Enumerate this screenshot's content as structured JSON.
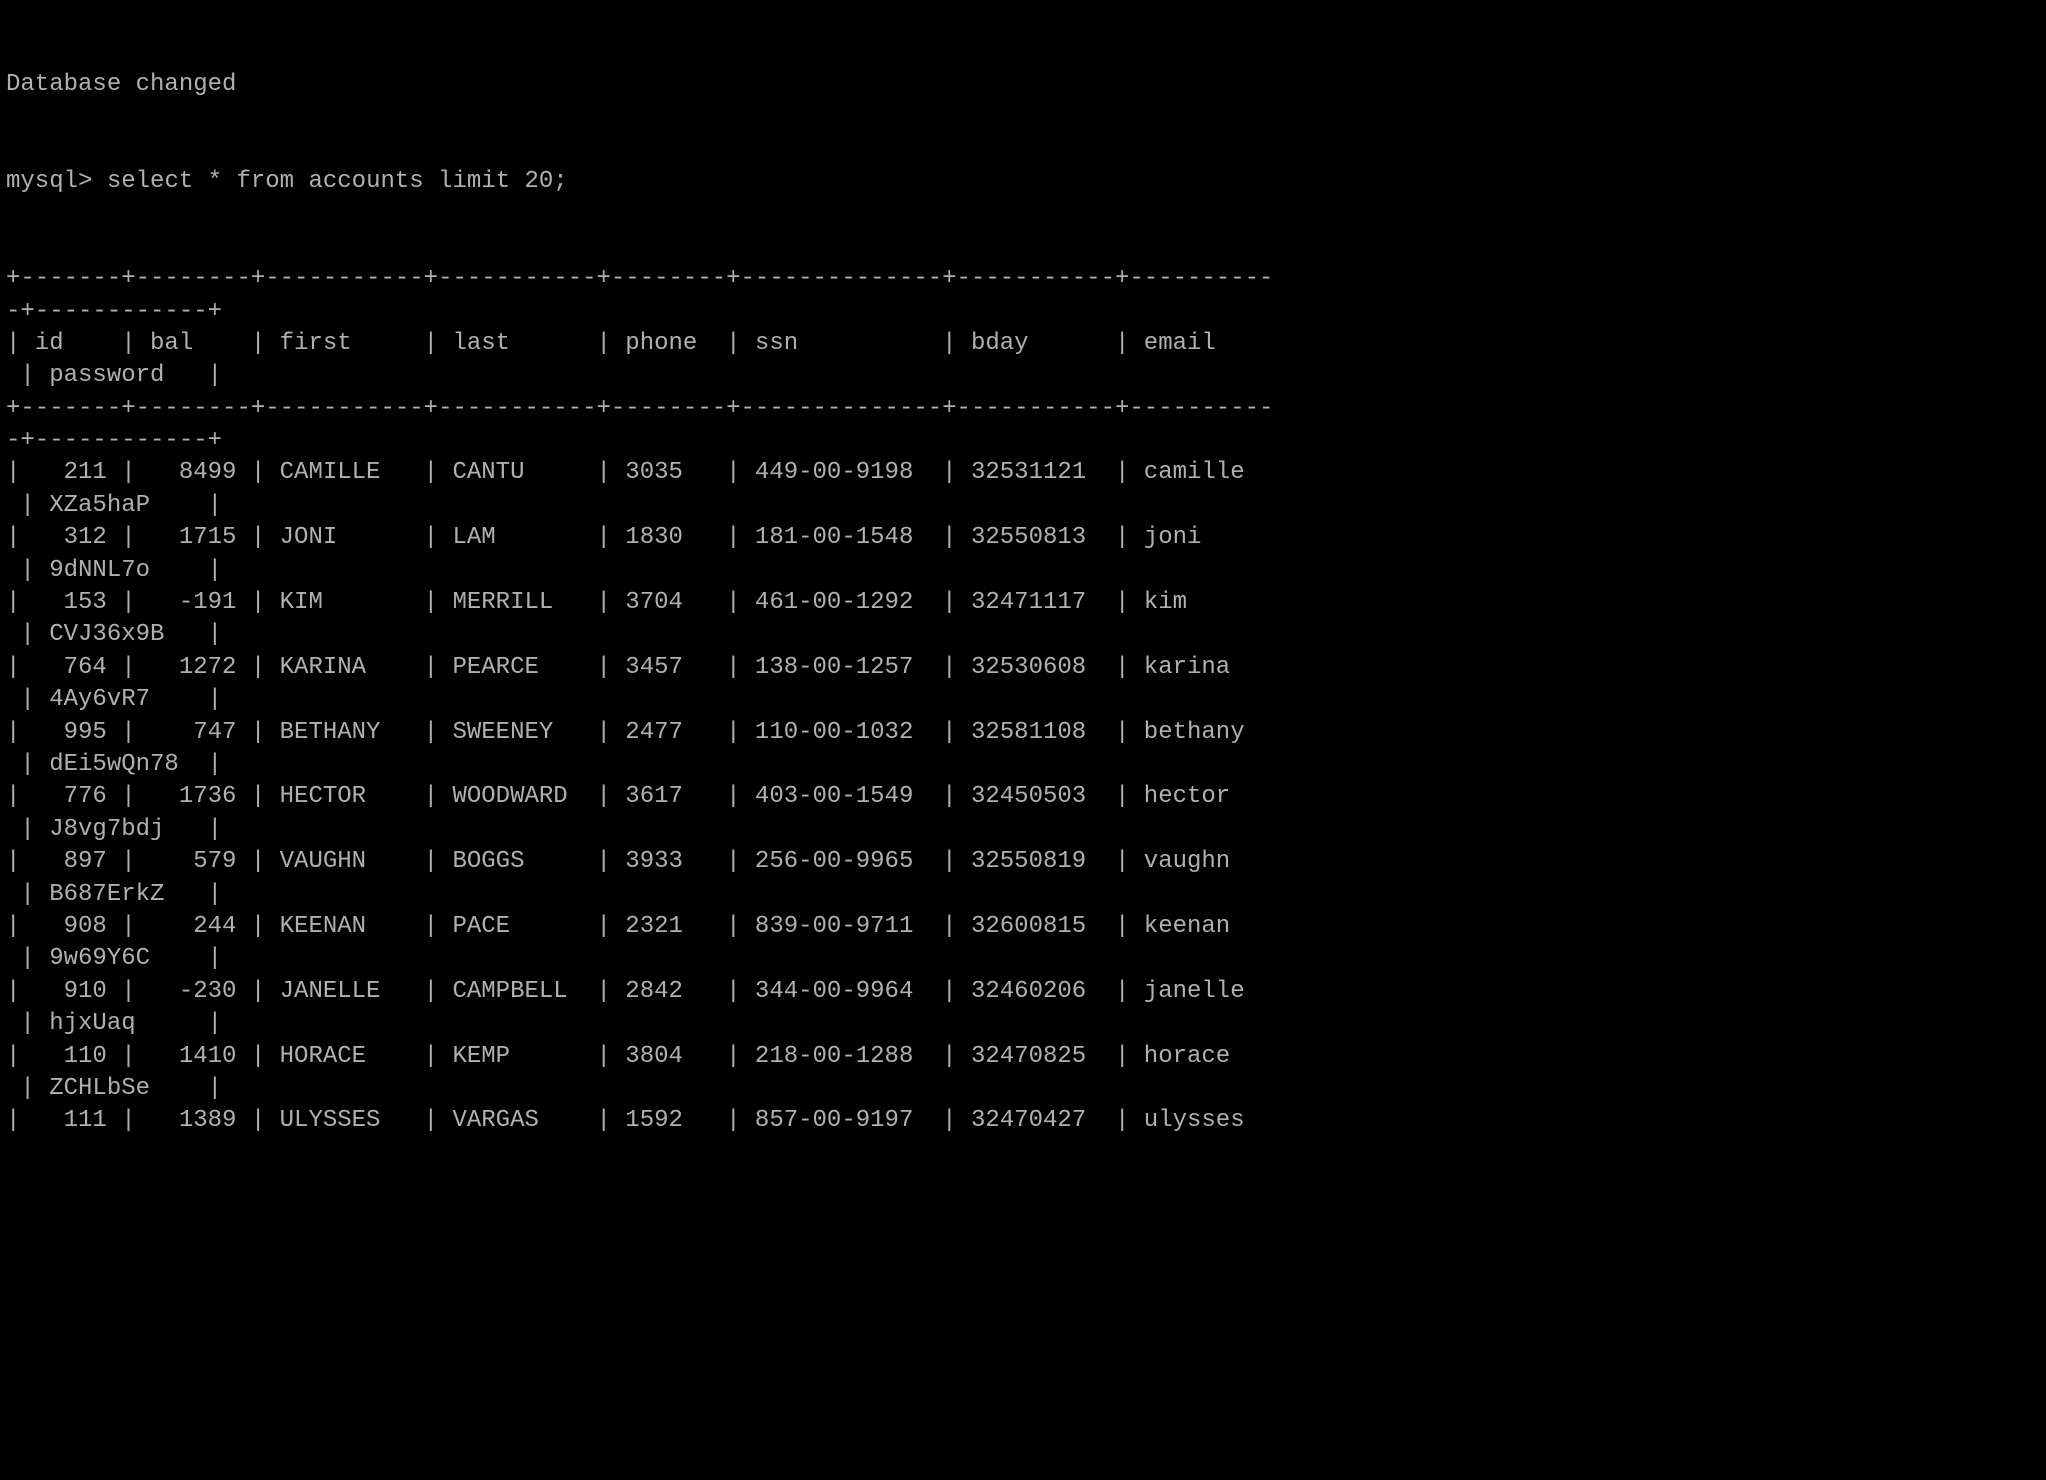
{
  "header": {
    "status_line": "Database changed",
    "prompt": "mysql>",
    "query": "select * from accounts limit 20;"
  },
  "columns": [
    "id",
    "bal",
    "first",
    "last",
    "phone",
    "ssn",
    "bday",
    "email",
    "password"
  ],
  "colwidths": {
    "id": 5,
    "bal": 6,
    "first": 9,
    "last": 9,
    "phone": 6,
    "ssn": 12,
    "bday": 9,
    "email": 8,
    "password": 10
  },
  "rows": [
    {
      "id": "211",
      "bal": "8499",
      "first": "CAMILLE",
      "last": "CANTU",
      "phone": "3035",
      "ssn": "449-00-9198",
      "bday": "32531121",
      "email": "camille",
      "password": "XZa5haP"
    },
    {
      "id": "312",
      "bal": "1715",
      "first": "JONI",
      "last": "LAM",
      "phone": "1830",
      "ssn": "181-00-1548",
      "bday": "32550813",
      "email": "joni",
      "password": "9dNNL7o"
    },
    {
      "id": "153",
      "bal": "-191",
      "first": "KIM",
      "last": "MERRILL",
      "phone": "3704",
      "ssn": "461-00-1292",
      "bday": "32471117",
      "email": "kim",
      "password": "CVJ36x9B"
    },
    {
      "id": "764",
      "bal": "1272",
      "first": "KARINA",
      "last": "PEARCE",
      "phone": "3457",
      "ssn": "138-00-1257",
      "bday": "32530608",
      "email": "karina",
      "password": "4Ay6vR7"
    },
    {
      "id": "995",
      "bal": "747",
      "first": "BETHANY",
      "last": "SWEENEY",
      "phone": "2477",
      "ssn": "110-00-1032",
      "bday": "32581108",
      "email": "bethany",
      "password": "dEi5wQn78"
    },
    {
      "id": "776",
      "bal": "1736",
      "first": "HECTOR",
      "last": "WOODWARD",
      "phone": "3617",
      "ssn": "403-00-1549",
      "bday": "32450503",
      "email": "hector",
      "password": "J8vg7bdj"
    },
    {
      "id": "897",
      "bal": "579",
      "first": "VAUGHN",
      "last": "BOGGS",
      "phone": "3933",
      "ssn": "256-00-9965",
      "bday": "32550819",
      "email": "vaughn",
      "password": "B687ErkZ"
    },
    {
      "id": "908",
      "bal": "244",
      "first": "KEENAN",
      "last": "PACE",
      "phone": "2321",
      "ssn": "839-00-9711",
      "bday": "32600815",
      "email": "keenan",
      "password": "9w69Y6C"
    },
    {
      "id": "910",
      "bal": "-230",
      "first": "JANELLE",
      "last": "CAMPBELL",
      "phone": "2842",
      "ssn": "344-00-9964",
      "bday": "32460206",
      "email": "janelle",
      "password": "hjxUaq"
    },
    {
      "id": "110",
      "bal": "1410",
      "first": "HORACE",
      "last": "KEMP",
      "phone": "3804",
      "ssn": "218-00-1288",
      "bday": "32470825",
      "email": "horace",
      "password": "ZCHLbSe"
    },
    {
      "id": "111",
      "bal": "1389",
      "first": "ULYSSES",
      "last": "VARGAS",
      "phone": "1592",
      "ssn": "857-00-9197",
      "bday": "32470427",
      "email": "ulysses",
      "password": ""
    }
  ]
}
